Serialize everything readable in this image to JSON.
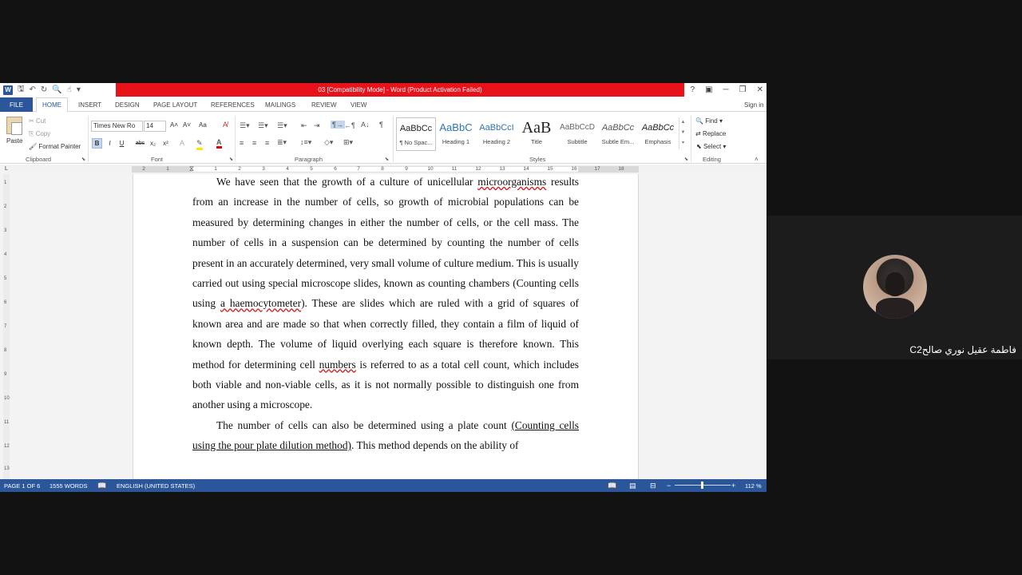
{
  "window": {
    "title": "03 [Compatibility Mode] -  Word (Product Activation Failed)",
    "controls": [
      "?",
      "▣",
      "─",
      "❐",
      "✕"
    ],
    "word_logo": "W"
  },
  "tabs": [
    "FILE",
    "HOME",
    "INSERT",
    "DESIGN",
    "PAGE LAYOUT",
    "REFERENCES",
    "MAILINGS",
    "REVIEW",
    "VIEW"
  ],
  "sign_in": "Sign in",
  "ribbon": {
    "clipboard": {
      "paste": "Paste",
      "cut": "Cut",
      "copy": "Copy",
      "format_painter": "Format Painter",
      "label": "Clipboard"
    },
    "font": {
      "name": "Times New Ro",
      "size": "14",
      "label": "Font",
      "bold": "B",
      "italic": "I",
      "underline": "U",
      "strike": "abc",
      "subscript": "x₂",
      "superscript": "x²",
      "case": "Aa",
      "grow": "A˄",
      "shrink": "A˅"
    },
    "paragraph": {
      "label": "Paragraph",
      "pilcrow": "¶"
    },
    "styles": {
      "label": "Styles",
      "items": [
        {
          "sample": "AaBbCc",
          "name": "¶ No Spac..."
        },
        {
          "sample": "AaBbC",
          "name": "Heading 1"
        },
        {
          "sample": "AaBbCcI",
          "name": "Heading 2"
        },
        {
          "sample": "AaB",
          "name": "Title"
        },
        {
          "sample": "AaBbCcD",
          "name": "Subtitle"
        },
        {
          "sample": "AaBbCc",
          "name": "Subtle Em..."
        },
        {
          "sample": "AaBbCc",
          "name": "Emphasis"
        }
      ]
    },
    "editing": {
      "find": "Find",
      "replace": "Replace",
      "select": "Select",
      "label": "Editing"
    }
  },
  "ruler": {
    "corner": "L",
    "numbers": [
      "2",
      "1",
      "1",
      "2",
      "3",
      "4",
      "5",
      "6",
      "7",
      "8",
      "9",
      "10",
      "11",
      "12",
      "13",
      "14",
      "15",
      "16",
      "17",
      "18"
    ],
    "vertical": [
      "1",
      "2",
      "3",
      "4",
      "5",
      "6",
      "7",
      "8",
      "9",
      "10",
      "11",
      "12",
      "13"
    ]
  },
  "document": {
    "p1": {
      "a": "We have seen that the growth of a culture of unicellular ",
      "b": "microorganisms",
      "c": " results from an increase in the number of cells, so growth of microbial populations can be measured by determining changes in either the number of cells, or the cell mass. The number of cells in a suspension can be determined by counting the number of cells present in an accurately determined, very small volume of culture medium. This is usually carried out using special microscope slides, known as counting chambers (Counting cells using ",
      "d": "a haemocytometer",
      "e": "). These are slides which are ruled with a grid of squares of known area and are made so that when correctly filled, they contain a film of liquid of known depth. The volume of liquid overlying each square is therefore known. This method for determining cell ",
      "f": "numbers",
      "g": " is referred to as a total cell count, which includes both viable and non-viable cells, as it is not normally possible to distinguish one from another using a microscope."
    },
    "p2": {
      "a": "The number of cells can also be determined using a plate count ",
      "b": "(Counting cells using the pour plate dilution method)",
      "c": ". This method depends on the ability of"
    }
  },
  "status": {
    "page": "PAGE 1 OF 6",
    "words": "1555 WORDS",
    "language": "ENGLISH (UNITED STATES)",
    "zoom": "112 %",
    "zoom_minus": "−",
    "zoom_plus": "+"
  },
  "participant": {
    "name": "فاطمة عقيل نوري صالحC2"
  }
}
